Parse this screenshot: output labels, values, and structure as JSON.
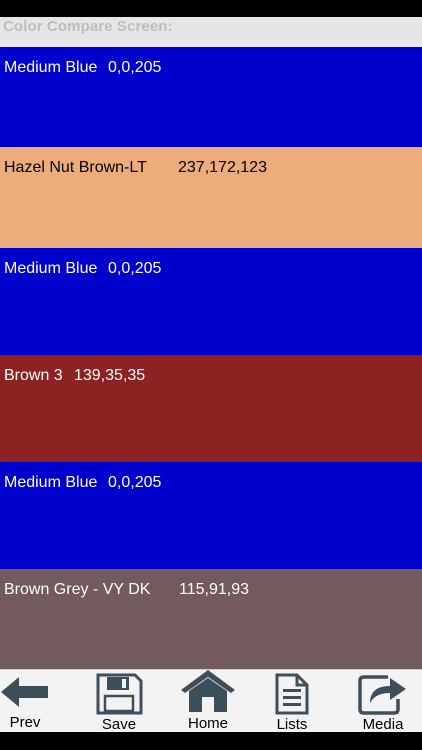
{
  "header": {
    "title": "Color Compare Screen:",
    "title_color": "#bdbdbd",
    "background": "#e6e6e6"
  },
  "swatches": [
    {
      "name": "Medium Blue",
      "rgb": "0,0,205",
      "color": "#0000cd",
      "text_color": "#ffffff"
    },
    {
      "name": "Hazel Nut Brown-LT",
      "rgb": "237,172,123",
      "color": "#edac7b",
      "text_color": "#000000"
    },
    {
      "name": "Medium Blue",
      "rgb": "0,0,205",
      "color": "#0000cd",
      "text_color": "#ffffff"
    },
    {
      "name": "Brown 3",
      "rgb": "139,35,35",
      "color": "#8b2323",
      "text_color": "#ffffff"
    },
    {
      "name": "Medium Blue",
      "rgb": "0,0,205",
      "color": "#0000cd",
      "text_color": "#ffffff"
    },
    {
      "name": "Brown Grey - VY DK",
      "rgb": "115,91,93",
      "color": "#735b5d",
      "text_color": "#ffffff"
    }
  ],
  "toolbar": {
    "items": [
      {
        "label": "Prev",
        "icon": "back-arrow-icon"
      },
      {
        "label": "Save",
        "icon": "floppy-disk-icon"
      },
      {
        "label": "Home",
        "icon": "home-icon"
      },
      {
        "label": "Lists",
        "icon": "document-icon"
      },
      {
        "label": "Media",
        "icon": "share-icon"
      }
    ],
    "icon_color": "#3e4f5c"
  }
}
